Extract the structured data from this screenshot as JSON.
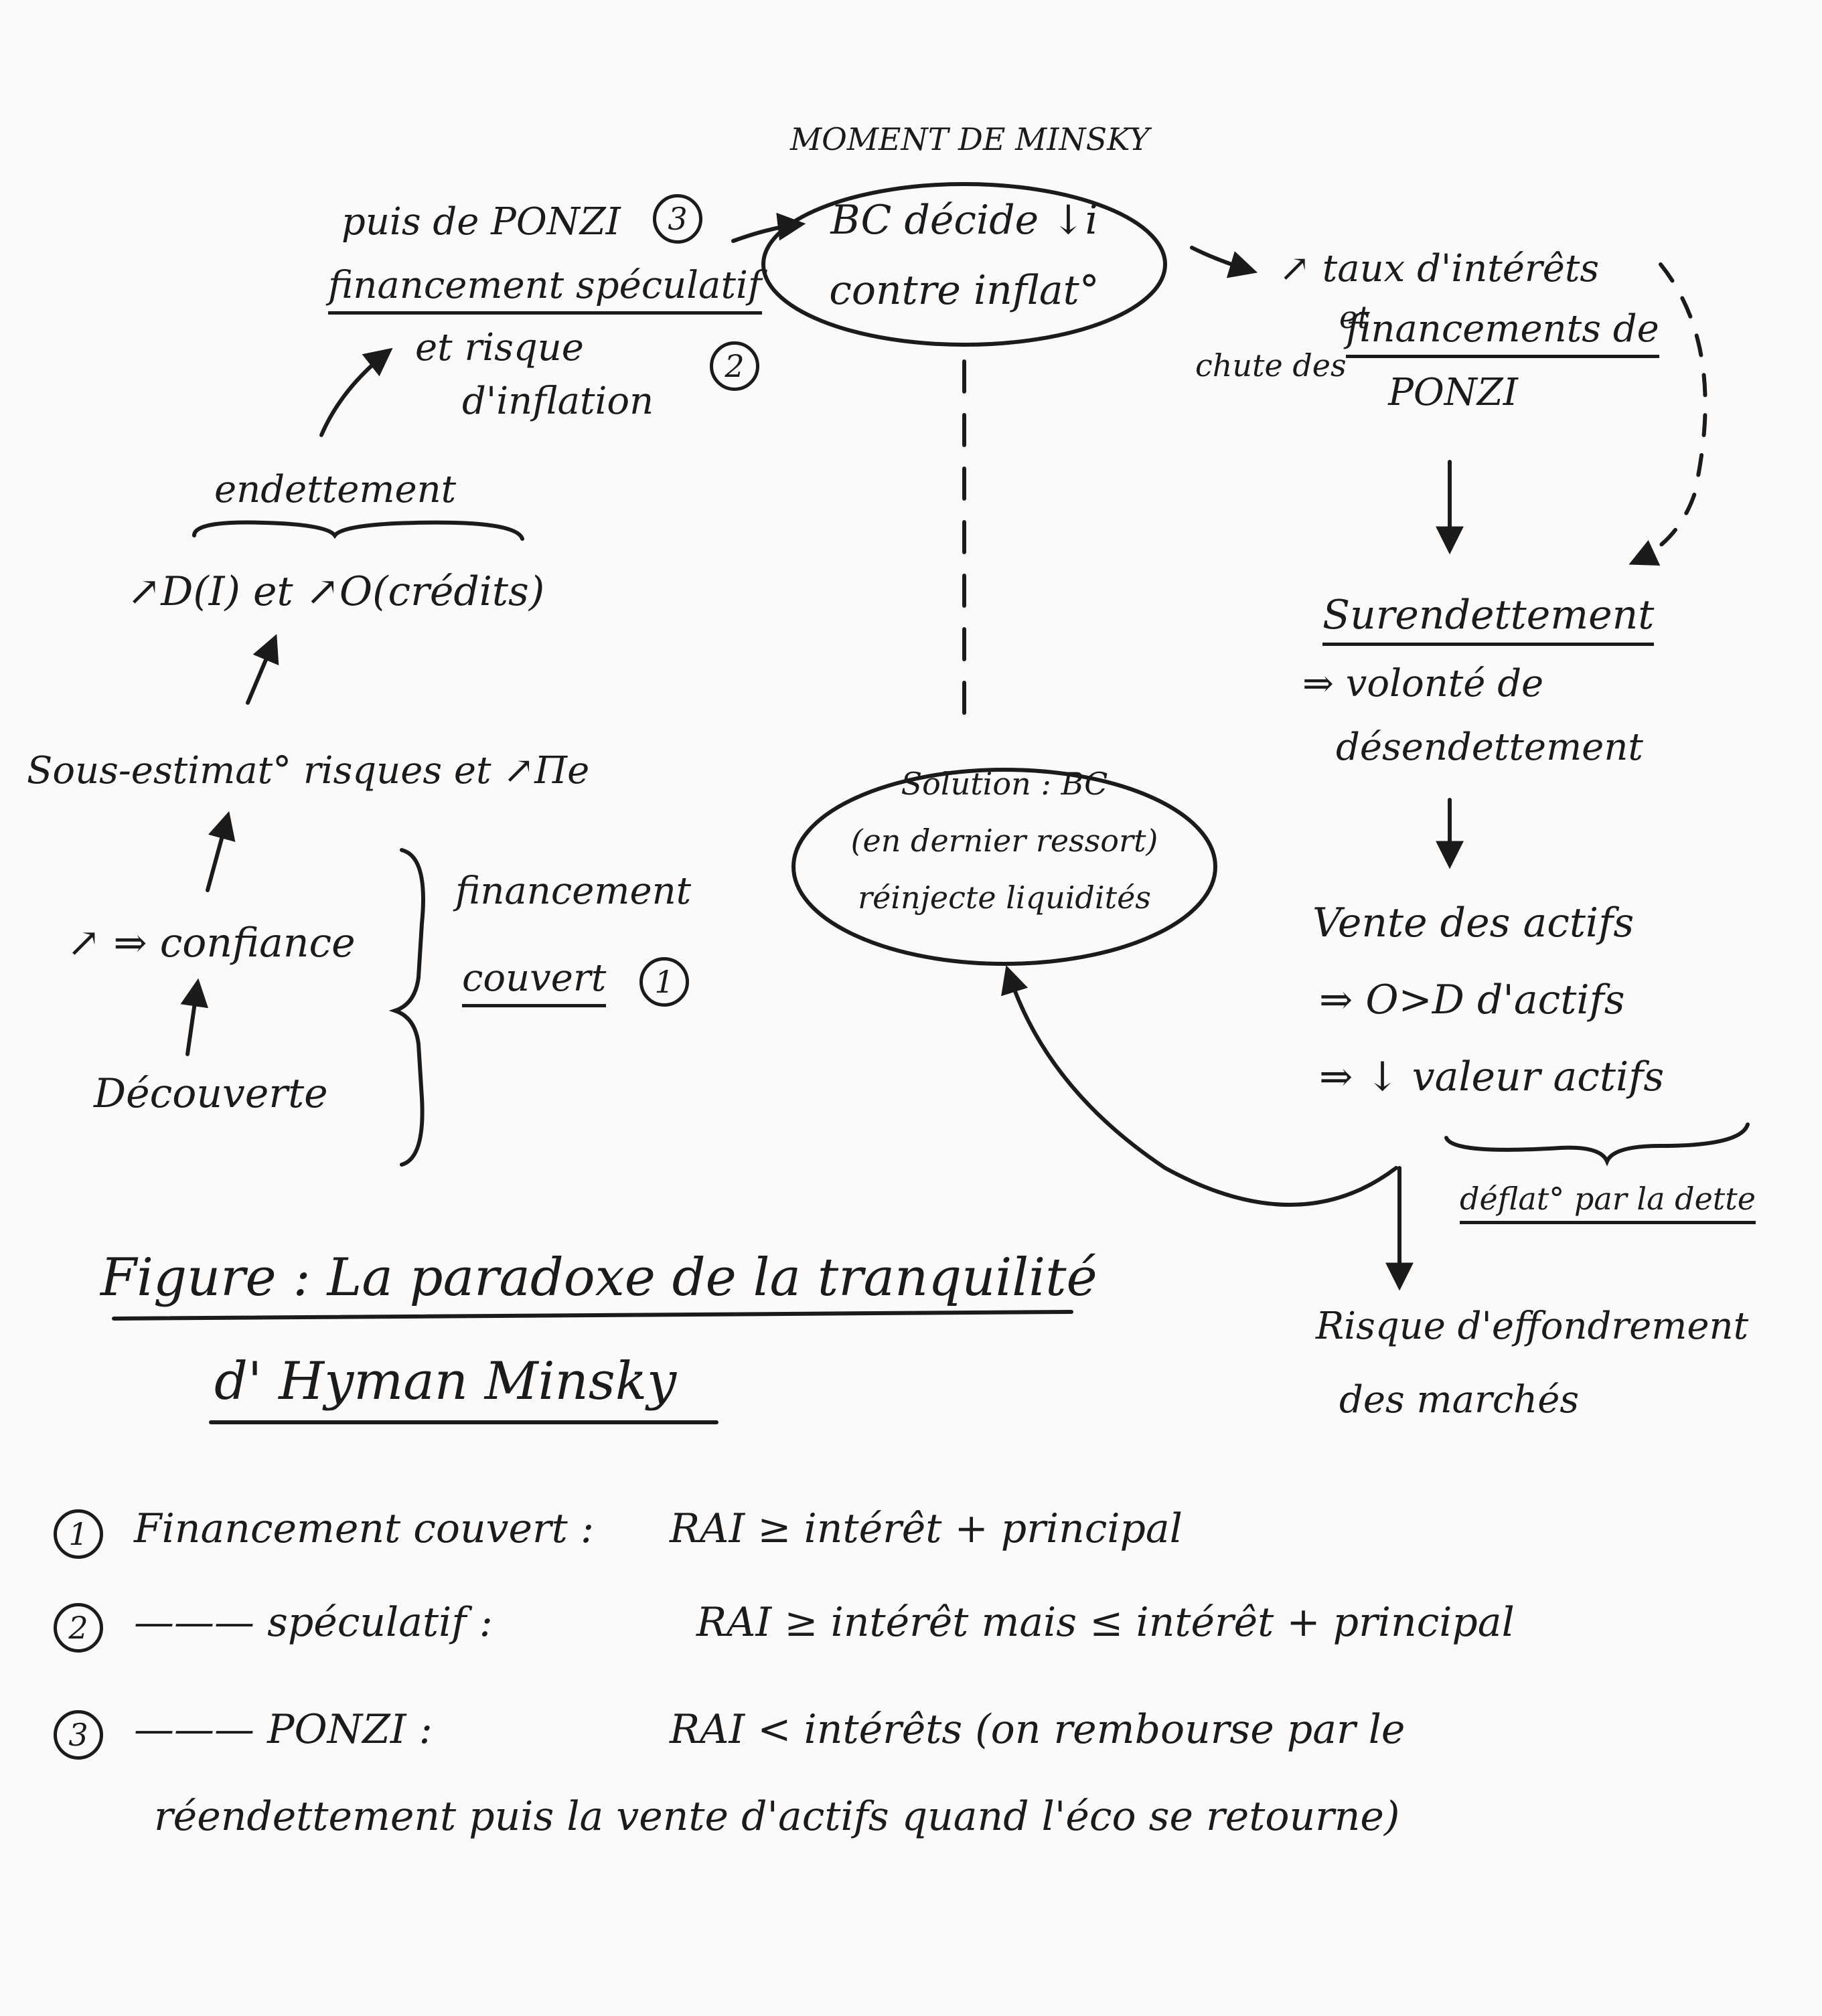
{
  "minsky_moment": "MOMENT DE MINSKY",
  "nodes": {
    "bc_decision": {
      "line1": "BC décide ↓i",
      "line2": "contre inflat°"
    },
    "ponzi_top": "puis de PONZI",
    "badge_3": "3",
    "speculatif": "financement spéculatif",
    "risque_inflation": {
      "line1": "et risque",
      "line2": "d'inflation"
    },
    "badge_2": "2",
    "endettement": "endettement",
    "demande": "↗D(I) et ↗O(crédits)",
    "sous_estimation": "Sous-estimat° risques et ↗Πe",
    "confiance": "↗ ⇒ confiance",
    "decouverte": "Découverte",
    "financement_couvert": {
      "line1": "financement",
      "line2": "couvert"
    },
    "badge_1": "1",
    "taux": "↗ taux d'intérêts",
    "chute": "chute des",
    "et": "et",
    "financements_ponzi": {
      "line1": "financements de",
      "line2": "PONZI"
    },
    "surendettement": "Surendettement",
    "volonte": {
      "line1": "⇒ volonté de",
      "line2": "désendettement"
    },
    "vente": "Vente des actifs",
    "offre": "⇒ O>D d'actifs",
    "valeur": "⇒ ↓ valeur actifs",
    "deflation": "déflat° par la dette",
    "risque_effondrement": {
      "line1": "Risque d'effondrement",
      "line2": "des marchés"
    },
    "solution": {
      "line1": "Solution : BC",
      "line2": "(en dernier ressort)",
      "line3": "réinjecte liquidités"
    }
  },
  "figure_title": {
    "line1": "Figure : La paradoxe de la tranquilité",
    "line2": "d' Hyman Minsky"
  },
  "legend": [
    {
      "num": "1",
      "label": "Financement couvert :",
      "rule": "RAI ≥ intérêt + principal"
    },
    {
      "num": "2",
      "label": "——— spéculatif :",
      "rule": "RAI ≥ intérêt mais ≤ intérêt + principal"
    },
    {
      "num": "3",
      "label": "——— PONZI :",
      "rule": "RAI < intérêts (on rembourse par le"
    }
  ],
  "legend_continuation": "réendettement puis la vente d'actifs quand l'éco se retourne)"
}
